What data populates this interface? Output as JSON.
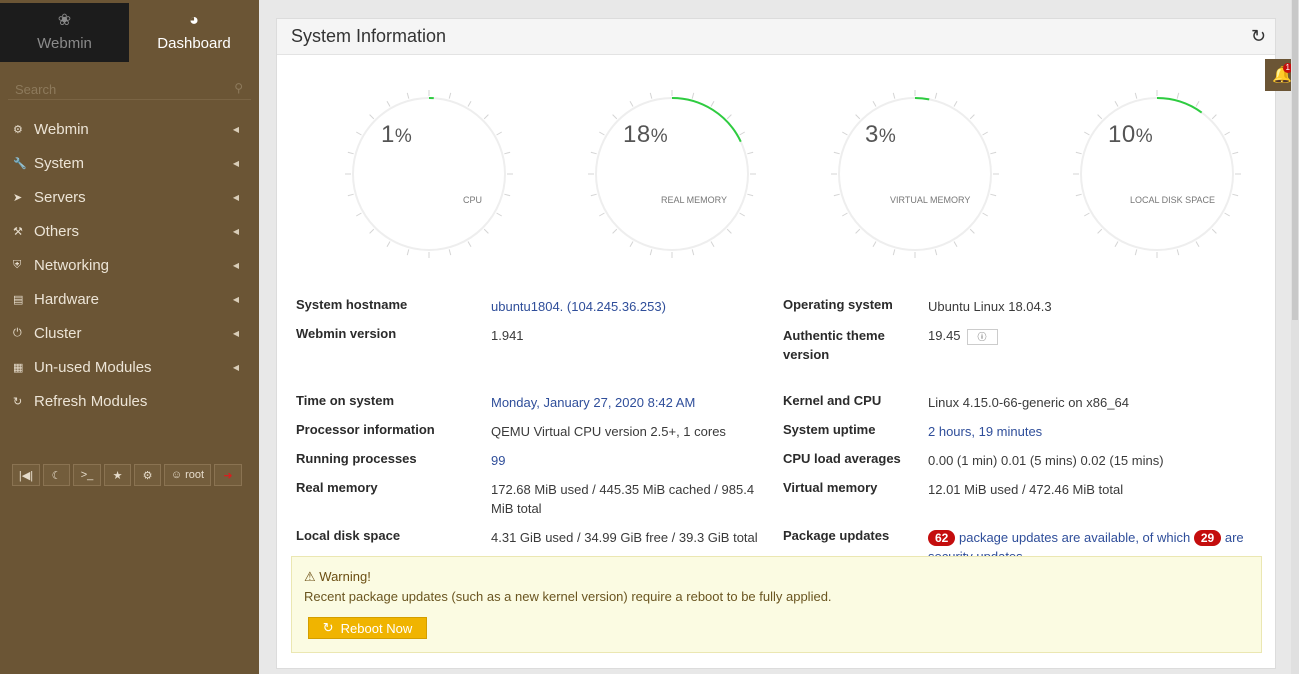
{
  "sidebar": {
    "tabs": {
      "webmin": "Webmin",
      "dashboard": "Dashboard"
    },
    "search_placeholder": "Search",
    "items": [
      {
        "label": "Webmin",
        "icon": "gear-icon"
      },
      {
        "label": "System",
        "icon": "wrench-icon"
      },
      {
        "label": "Servers",
        "icon": "rocket-icon"
      },
      {
        "label": "Others",
        "icon": "hammer-icon"
      },
      {
        "label": "Networking",
        "icon": "shield-icon"
      },
      {
        "label": "Hardware",
        "icon": "hdd-icon"
      },
      {
        "label": "Cluster",
        "icon": "power-icon"
      },
      {
        "label": "Un-used Modules",
        "icon": "puzzle-icon"
      },
      {
        "label": "Refresh Modules",
        "icon": "refresh-icon"
      }
    ],
    "user_button": "root"
  },
  "panel": {
    "title": "System Information"
  },
  "gauges": [
    {
      "value": 1,
      "unit": "%",
      "label": "CPU"
    },
    {
      "value": 18,
      "unit": "%",
      "label": "REAL MEMORY"
    },
    {
      "value": 3,
      "unit": "%",
      "label": "VIRTUAL MEMORY"
    },
    {
      "value": 10,
      "unit": "%",
      "label": "LOCAL DISK SPACE"
    }
  ],
  "info": {
    "hostname_label": "System hostname",
    "hostname_value": "ubuntu1804. (104.245.36.253)",
    "os_label": "Operating system",
    "os_value": "Ubuntu Linux 18.04.3",
    "webmin_label": "Webmin version",
    "webmin_value": "1.941",
    "theme_label_1": "Authentic theme",
    "theme_label_2": "version",
    "theme_value": "19.45",
    "time_label": "Time on system",
    "time_value": "Monday, January 27, 2020 8:42 AM",
    "kernel_label": "Kernel and CPU",
    "kernel_value": "Linux 4.15.0-66-generic on x86_64",
    "proc_label": "Processor information",
    "proc_value": "QEMU Virtual CPU version 2.5+, 1 cores",
    "uptime_label": "System uptime",
    "uptime_value": "2 hours, 19 minutes",
    "running_label": "Running processes",
    "running_value": "99",
    "load_label": "CPU load averages",
    "load_value": "0.00 (1 min) 0.01 (5 mins) 0.02 (15 mins)",
    "realmem_label": "Real memory",
    "realmem_value_1": "172.68 MiB used / 445.35 MiB cached / 985.4",
    "realmem_value_2": "MiB total",
    "virtmem_label": "Virtual memory",
    "virtmem_value": "12.01 MiB used / 472.46 MiB total",
    "disk_label": "Local disk space",
    "disk_value": "4.31 GiB used / 34.99 GiB free / 39.3 GiB total",
    "updates_label": "Package updates",
    "updates_count": "62",
    "updates_text": "package updates are available, of which",
    "security_count": "29",
    "updates_are": "are",
    "updates_text_2": "security updates"
  },
  "warning": {
    "title": "Warning!",
    "text": "Recent package updates (such as a new kernel version) require a reboot to be fully applied.",
    "button": "Reboot Now"
  },
  "notifications": {
    "count": "1"
  },
  "colors": {
    "sidebar": "#6b5535",
    "gauge_arc": "#2ecc40",
    "badge": "#c40d0d",
    "link": "#2f4e9a",
    "warning_bg": "#fbfbe2",
    "reboot_button": "#f0b400"
  }
}
